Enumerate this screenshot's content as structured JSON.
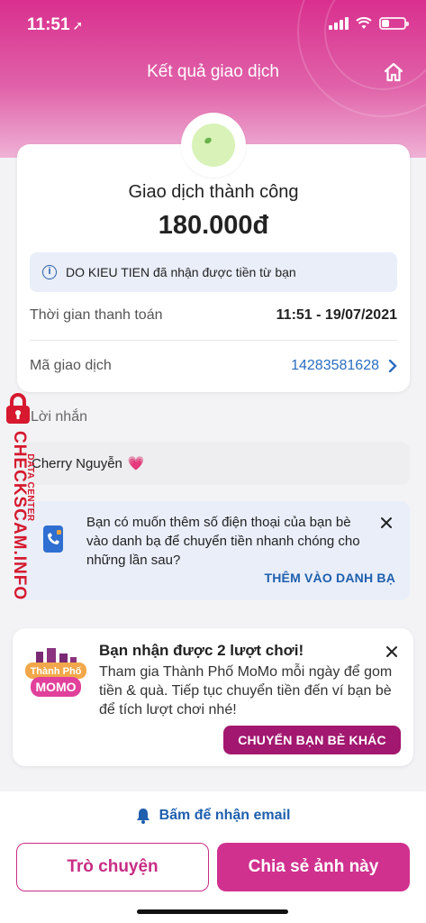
{
  "status_bar": {
    "time": "11:51"
  },
  "header": {
    "title": "Kết quả giao dịch"
  },
  "result": {
    "status_title": "Giao dịch thành công",
    "amount": "180.000đ",
    "info_text": "DO KIEU TIEN đã nhận được tiền từ bạn",
    "payment_time_label": "Thời gian thanh toán",
    "payment_time_value": "11:51 - 19/07/2021",
    "transaction_code_label": "Mã giao dịch",
    "transaction_code_value": "14283581628"
  },
  "message": {
    "label": "Lời nhắn",
    "text": "Cherry Nguyễn",
    "emoji": "💗"
  },
  "contacts_prompt": {
    "text": "Bạn có muốn thêm số điện thoại của bạn bè vào danh bạ để chuyển tiền nhanh chóng cho những lần sau?",
    "action_label": "THÊM VÀO DANH BẠ"
  },
  "promo": {
    "logo_top": "Thành Phố",
    "logo_bottom": "MOMO",
    "title": "Bạn nhận được 2 lượt chơi!",
    "text": "Tham gia Thành Phố MoMo mỗi ngày để gom tiền & quà. Tiếp tục chuyển tiền đến ví bạn bè để tích lượt chơi nhé!",
    "button_label": "CHUYỂN BẠN BÈ KHÁC"
  },
  "bottom": {
    "email_label": "Bấm để nhận email",
    "chat_label": "Trò chuyện",
    "share_label": "Chia sẻ ảnh này"
  },
  "watermark": {
    "main": "CHECKSCAM.INFO",
    "sub": "DATA CENTER"
  },
  "colors": {
    "brand_pink": "#d0318f",
    "promo_button": "#a2176f",
    "link_blue": "#1f5fae"
  }
}
